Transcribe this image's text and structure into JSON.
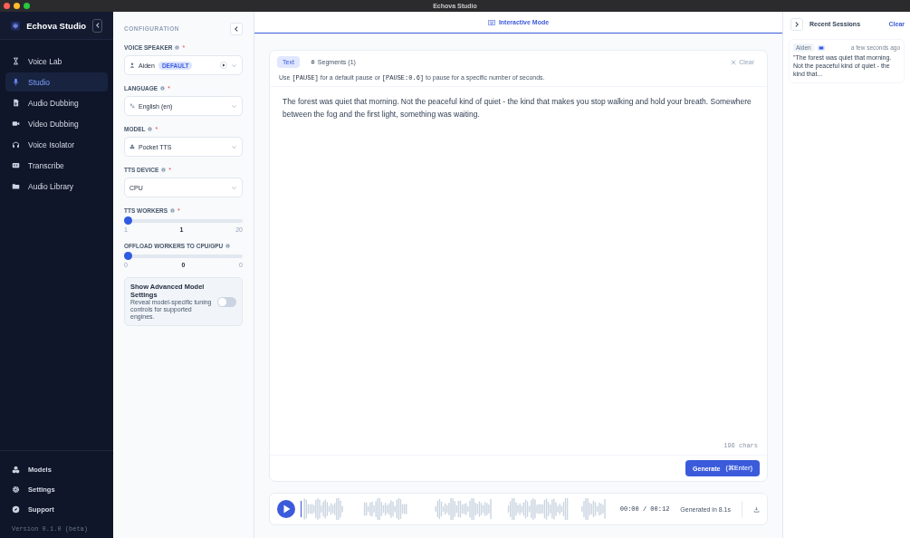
{
  "window": {
    "title": "Echova Studio"
  },
  "sidebar": {
    "brand": "Echova Studio",
    "items": [
      {
        "label": "Voice Lab",
        "selected": false
      },
      {
        "label": "Studio",
        "selected": true
      },
      {
        "label": "Audio Dubbing",
        "selected": false
      },
      {
        "label": "Video Dubbing",
        "selected": false
      },
      {
        "label": "Voice Isolator",
        "selected": false
      },
      {
        "label": "Transcribe",
        "selected": false
      },
      {
        "label": "Audio Library",
        "selected": false
      }
    ],
    "footer_items": [
      {
        "label": "Models",
        "selected": false
      },
      {
        "label": "Settings",
        "selected": false
      },
      {
        "label": "Support",
        "selected": false
      }
    ],
    "version": "Version 0.1.0 (beta)"
  },
  "config": {
    "title": "CONFIGURATION",
    "fields": [
      {
        "kind": "select",
        "label": "VOICE SPEAKER",
        "required_mark": "*",
        "value": "Aiden",
        "badge": "DEFAULT",
        "play": true
      },
      {
        "kind": "select",
        "label": "LANGUAGE",
        "required_mark": "*",
        "value": "English (en)"
      },
      {
        "kind": "select",
        "label": "MODEL",
        "required_mark": "*",
        "value": "Pocket TTS"
      },
      {
        "kind": "select",
        "label": "TTS DEVICE",
        "required_mark": "*",
        "value": "CPU"
      },
      {
        "kind": "slider",
        "label": "TTS WORKERS",
        "required_mark": "*",
        "level": 0,
        "min": "1",
        "current": "1",
        "max": "20"
      },
      {
        "kind": "slider",
        "label": "OFFLOAD WORKERS TO CPU/GPU",
        "level": 0,
        "min": "0",
        "current": "0",
        "max": "0"
      }
    ],
    "advanced": {
      "title": "Show Advanced Model Settings",
      "description": "Reveal model-specific tuning controls for supported engines.",
      "on": false
    }
  },
  "main": {
    "mode": "Interactive Mode",
    "tabs": [
      {
        "label": "Text",
        "selected": true
      },
      {
        "label": "Segments (1)",
        "selected": false
      }
    ],
    "clear": "Clear",
    "hint": [
      {
        "kind": "text",
        "text": "Use "
      },
      {
        "kind": "code",
        "text": "[PAUSE]"
      },
      {
        "kind": "text",
        "text": " for a default pause or "
      },
      {
        "kind": "code",
        "text": "[PAUSE:0.6]"
      },
      {
        "kind": "text",
        "text": " to pause for a specific number of seconds."
      }
    ],
    "text": "The forest was quiet that morning. Not the peaceful kind of quiet - the kind that makes you stop walking and hold your breath. Somewhere between the fog and the first light, something was waiting.",
    "char_count": "196 chars",
    "generate": {
      "label": "Generate",
      "shortcut": "(⌘Enter)"
    },
    "player": {
      "time": "00:00 / 00:12",
      "status": "Generated in 8.1s"
    }
  },
  "recent": {
    "title": "Recent Sessions",
    "clear": "Clear",
    "sessions": [
      {
        "speaker": "Aiden",
        "time": "a few seconds ago",
        "text": "\"The forest was quiet that morning. Not the peaceful kind of quiet - the kind that..."
      }
    ]
  }
}
